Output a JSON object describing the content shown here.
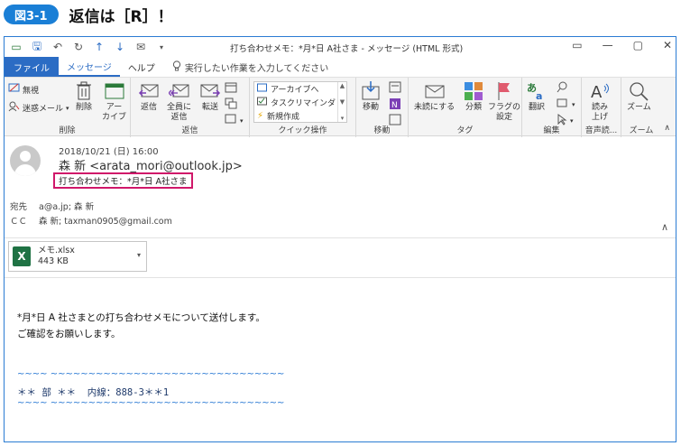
{
  "caption": {
    "badge": "図3-1",
    "title": "返信は［R］！"
  },
  "window": {
    "title": "打ち合わせメモ：*月*日 A社さま  -  メッセージ (HTML 形式)",
    "controls": [
      "▭",
      "—",
      "▢",
      "✕"
    ]
  },
  "qat": {
    "icons": [
      "▭",
      "🖫",
      "↶",
      "↻",
      "↑",
      "↓",
      "✉",
      "▾"
    ]
  },
  "tabs": {
    "file": "ファイル",
    "message": "メッセージ",
    "help": "ヘルプ",
    "tell_me": "実行したい作業を入力してください"
  },
  "ribbon": {
    "delete_group": {
      "label": "削除",
      "ignore": "無視",
      "junk": "迷惑メール",
      "delete": "削除",
      "archive": "アー\nカイブ"
    },
    "respond_group": {
      "label": "返信",
      "reply": "返信",
      "reply_all": "全員に\n返信",
      "forward": "転送"
    },
    "quick_group": {
      "label": "クイック操作",
      "items": [
        "アーカイブへ",
        "タスクリマインダ",
        "新規作成"
      ]
    },
    "move_group": {
      "label": "移動",
      "move": "移動"
    },
    "tags_group": {
      "label": "タグ",
      "unread": "未読にする",
      "categorize": "分類",
      "flag": "フラグの\n設定"
    },
    "edit_group": {
      "label": "編集",
      "translate": "翻訳"
    },
    "speech_group": {
      "label": "音声読...",
      "read": "読み\n上げ"
    },
    "zoom_group": {
      "label": "ズーム",
      "zoom": "ズーム"
    }
  },
  "message": {
    "date": "2018/10/21 (日) 16:00",
    "sender": "森 新 <arata_mori@outlook.jp>",
    "subject": "打ち合わせメモ：*月*日 A社さま",
    "to_label": "宛先",
    "to_value": "a@a.jp; 森 新",
    "cc_label": "ＣＣ",
    "cc_value": "森 新; taxman0905@gmail.com"
  },
  "attachment": {
    "name": "メモ.xlsx",
    "size": "443 KB"
  },
  "body": {
    "line1": "*月*日 A 社さまとの打ち合わせメモについて送付します。",
    "line2": "ご確認をお願いします。",
    "sig_sep": "~~~~ ~~~~~~~~~~~~~~~~~~~~~~~~~~~~~~~",
    "sig": "＊＊ 部 ＊＊  内線：888-3＊＊1"
  },
  "colors": {
    "accent": "#2b6cc4",
    "badge": "#1a7fd6",
    "highlight": "#d0186a",
    "excel": "#1f7244"
  }
}
